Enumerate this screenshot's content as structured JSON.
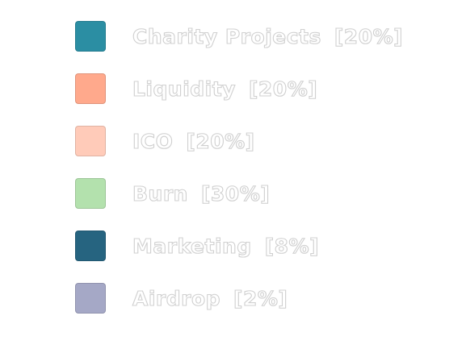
{
  "chart_data": {
    "type": "pie",
    "categories": [
      "Charity Projects",
      "Liquidity",
      "ICO",
      "Burn",
      "Marketing",
      "Airdrop"
    ],
    "values": [
      20,
      20,
      20,
      30,
      8,
      2
    ],
    "legend": {
      "items": [
        {
          "name": "Charity Projects",
          "value_label": "[20%]",
          "color": "#2b8ea3"
        },
        {
          "name": "Liquidity",
          "value_label": "[20%]",
          "color": "#ffa98c"
        },
        {
          "name": "ICO",
          "value_label": "[20%]",
          "color": "#ffcbb9"
        },
        {
          "name": "Burn",
          "value_label": "[30%]",
          "color": "#b3e1ad"
        },
        {
          "name": "Marketing",
          "value_label": "[8%]",
          "color": "#266480"
        },
        {
          "name": "Airdrop",
          "value_label": "[2%]",
          "color": "#a5a8c6"
        }
      ]
    }
  }
}
